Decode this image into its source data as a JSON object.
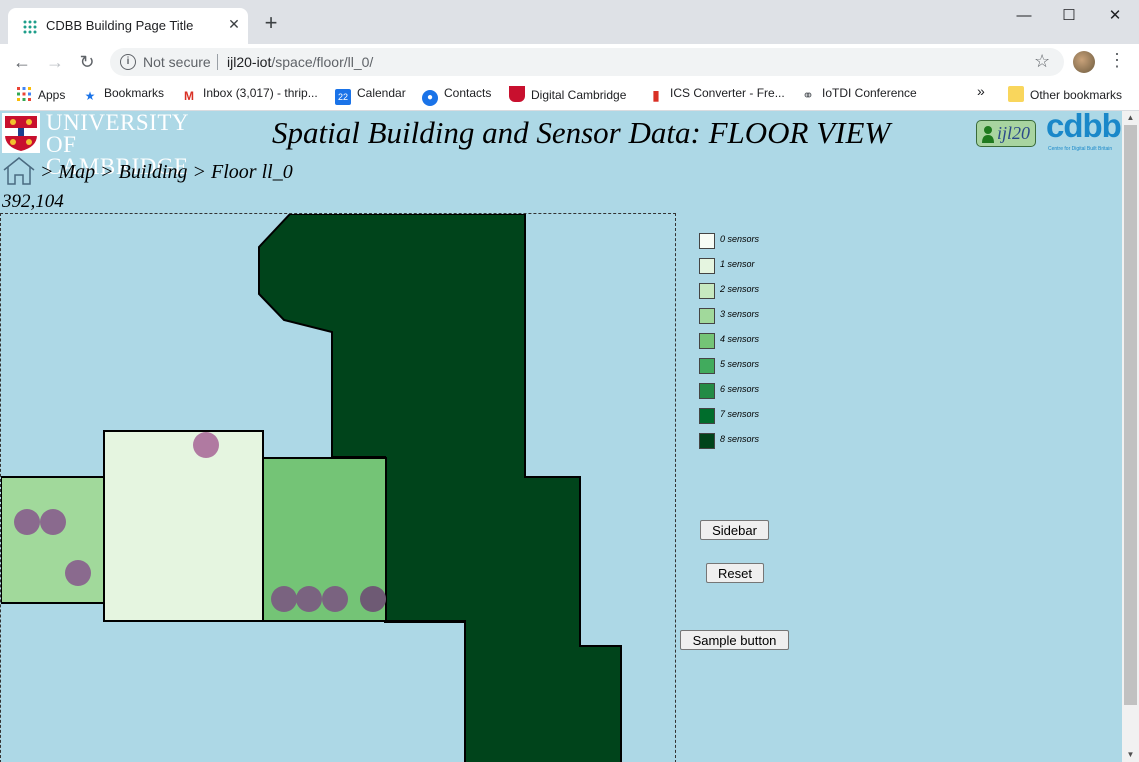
{
  "browser": {
    "tab_title": "CDBB Building Page Title",
    "new_tab": "+",
    "close_tab": "✕",
    "not_secure": "Not secure",
    "url_host": "ijl20-iot",
    "url_path": "/space/floor/ll_0/",
    "bookmarks": [
      {
        "label": "Apps",
        "icon": "apps-grid-icon"
      },
      {
        "label": "Bookmarks",
        "icon": "star-icon"
      },
      {
        "label": "Inbox (3,017) - thrip...",
        "icon": "gmail-icon"
      },
      {
        "label": "Calendar",
        "icon": "calendar-icon"
      },
      {
        "label": "Contacts",
        "icon": "contacts-icon"
      },
      {
        "label": "Digital Cambridge",
        "icon": "crest-icon"
      },
      {
        "label": "ICS Converter - Fre...",
        "icon": "ics-icon"
      },
      {
        "label": "IoTDI Conference",
        "icon": "globe-icon"
      }
    ],
    "overflow": "»",
    "other_bookmarks": "Other bookmarks",
    "calendar_day": "22"
  },
  "header": {
    "university_line1": "UNIVERSITY OF",
    "university_line2": "CAMBRIDGE",
    "title": "Spatial Building and Sensor Data: FLOOR VIEW",
    "user": "ijl20",
    "cdbb_logo": "cdbb",
    "cdbb_sub": "Centre for Digital Built Britain"
  },
  "breadcrumb": "> Map > Building > Floor ll_0",
  "cursor_coords": "392,104",
  "legend": [
    {
      "label": "0 sensors",
      "color": "#f7fcf5"
    },
    {
      "label": "1 sensor",
      "color": "#e5f5e0"
    },
    {
      "label": "2 sensors",
      "color": "#c7e9c0"
    },
    {
      "label": "3 sensors",
      "color": "#a1d99b"
    },
    {
      "label": "4 sensors",
      "color": "#74c476"
    },
    {
      "label": "5 sensors",
      "color": "#41ab5d"
    },
    {
      "label": "6 sensors",
      "color": "#238b45"
    },
    {
      "label": "7 sensors",
      "color": "#006d2c"
    },
    {
      "label": "8 sensors",
      "color": "#00441b"
    }
  ],
  "buttons": {
    "sidebar": "Sidebar",
    "reset": "Reset",
    "sample": "Sample button"
  },
  "colors": {
    "page_bg": "#add8e6",
    "sensor_dot": "#b07aa1"
  }
}
